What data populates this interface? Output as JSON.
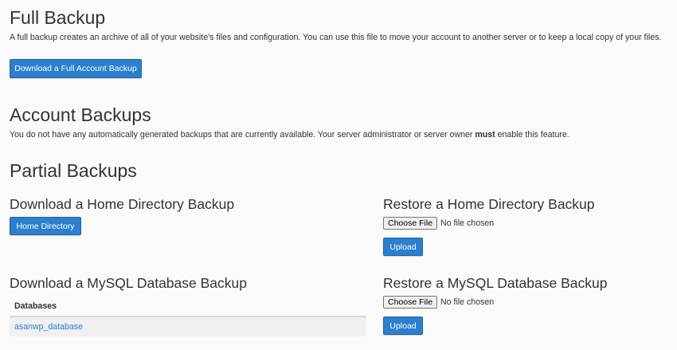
{
  "full_backup": {
    "title": "Full Backup",
    "description": "A full backup creates an archive of all of your website’s files and configuration. You can use this file to move your account to another server or to keep a local copy of your files.",
    "button_label": "Download a Full Account Backup"
  },
  "account_backups": {
    "title": "Account Backups",
    "description_before": "You do not have any automatically generated backups that are currently available. Your server administrator or server owner ",
    "description_bold": "must",
    "description_after": " enable this feature."
  },
  "partial_backups": {
    "title": "Partial Backups",
    "home_download": {
      "title": "Download a Home Directory Backup",
      "button_label": "Home Directory"
    },
    "home_restore": {
      "title": "Restore a Home Directory Backup",
      "choose_label": "Choose File",
      "no_file_text": "No file chosen",
      "upload_label": "Upload"
    },
    "mysql_download": {
      "title": "Download a MySQL Database Backup",
      "table_header": "Databases",
      "databases": [
        "asanwp_database"
      ]
    },
    "mysql_restore": {
      "title": "Restore a MySQL Database Backup",
      "choose_label": "Choose File",
      "no_file_text": "No file chosen",
      "upload_label": "Upload"
    }
  }
}
